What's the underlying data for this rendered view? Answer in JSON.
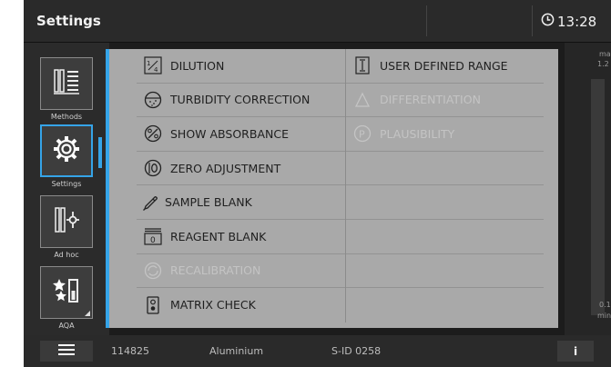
{
  "topbar": {
    "title": "Settings",
    "time": "13:28"
  },
  "sidebar": {
    "items": [
      {
        "label": "Methods",
        "icon": "methods-icon"
      },
      {
        "label": "Settings",
        "icon": "gear-icon",
        "active": true
      },
      {
        "label": "Ad hoc",
        "icon": "ad-hoc-icon"
      },
      {
        "label": "AQA",
        "icon": "aqa-icon"
      }
    ]
  },
  "popup": {
    "left_options": [
      {
        "label": "DILUTION",
        "icon": "dilution-icon",
        "enabled": true
      },
      {
        "label": "TURBIDITY CORRECTION",
        "icon": "turbidity-icon",
        "enabled": true
      },
      {
        "label": "SHOW ABSORBANCE",
        "icon": "absorbance-icon",
        "enabled": true
      },
      {
        "label": "ZERO ADJUSTMENT",
        "icon": "zero-adjust-icon",
        "enabled": true
      },
      {
        "label": "SAMPLE BLANK",
        "icon": "pipette-icon",
        "enabled": true
      },
      {
        "label": "REAGENT BLANK",
        "icon": "reagent-blank-icon",
        "enabled": true
      },
      {
        "label": "RECALIBRATION",
        "icon": "recalibration-icon",
        "enabled": false
      },
      {
        "label": "MATRIX CHECK",
        "icon": "matrix-check-icon",
        "enabled": true
      }
    ],
    "right_options": [
      {
        "label": "USER DEFINED RANGE",
        "icon": "range-icon",
        "enabled": true
      },
      {
        "label": "DIFFERENTIATION",
        "icon": "delta-icon",
        "enabled": false
      },
      {
        "label": "PLAUSIBILITY",
        "icon": "plausibility-icon",
        "enabled": false
      }
    ]
  },
  "right_panel": {
    "top_text": "ma",
    "top_value": "1.2",
    "bottom_value": "0.1",
    "bottom_text": "min"
  },
  "bottombar": {
    "method_id": "114825",
    "parameter": "Aluminium",
    "sample_id": "S-ID 0258",
    "info_label": "i"
  },
  "colors": {
    "accent": "#35a4e8",
    "popup_bg": "#a9a9a9",
    "bar_bg": "#2a2a2a"
  }
}
